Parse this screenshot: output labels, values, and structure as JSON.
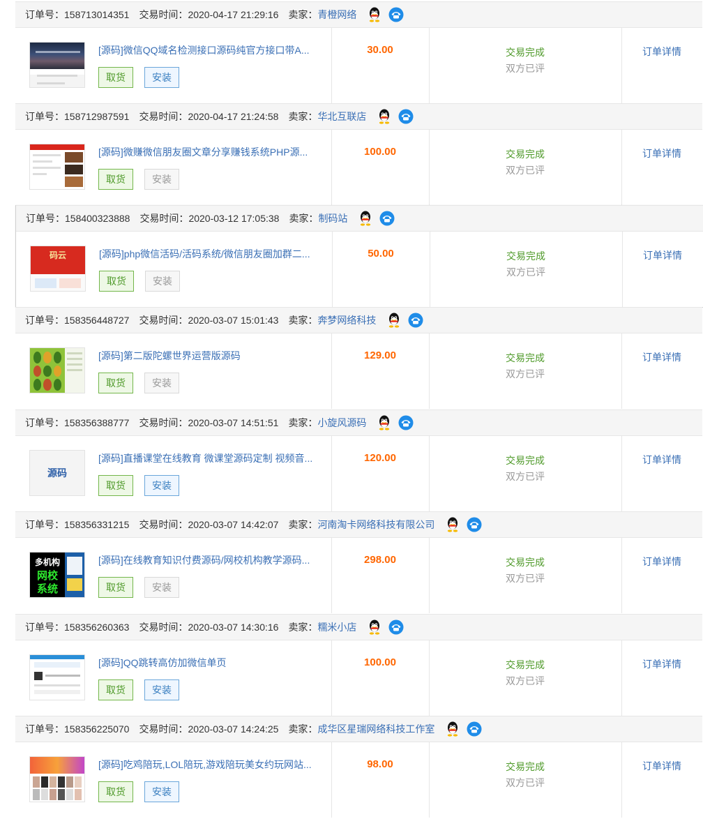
{
  "labels": {
    "order_no": "订单号：",
    "trade_time": "交易时间：",
    "seller": "卖家：",
    "take_button": "取货",
    "install_button": "安装",
    "status_main": "交易完成",
    "status_sub": "双方已评",
    "detail_link": "订单详情"
  },
  "colors": {
    "link": "#3a6fb5",
    "price": "#ff6600",
    "status_ok": "#4f9a2a",
    "muted": "#999999",
    "header_bg": "#f5f5f5"
  },
  "orders": [
    {
      "order_no": "158713014351",
      "time": "2020-04-17 21:29:16",
      "seller": "青橙网络",
      "title": "[源码]微信QQ域名检测接口源码纯官方接口带A...",
      "price": "30.00",
      "install_enabled": true,
      "thumb": "dark-banner"
    },
    {
      "order_no": "158712987591",
      "time": "2020-04-17 21:24:58",
      "seller": "华北互联店",
      "title": "[源码]微赚微信朋友圈文章分享赚钱系统PHP源...",
      "price": "100.00",
      "install_enabled": false,
      "thumb": "red-page"
    },
    {
      "order_no": "158400323888",
      "time": "2020-03-12 17:05:38",
      "seller": "制码站",
      "title": "[源码]php微信活码/活码系统/微信朋友圈加群二...",
      "price": "50.00",
      "install_enabled": false,
      "thumb": "red-banner-text",
      "thumb_text": "码云"
    },
    {
      "order_no": "158356448727",
      "time": "2020-03-07 15:01:43",
      "seller": "奔梦网络科技",
      "title": "[源码]第二版陀螺世界运营版源码",
      "price": "129.00",
      "install_enabled": false,
      "thumb": "green-app"
    },
    {
      "order_no": "158356388777",
      "time": "2020-03-07 14:51:51",
      "seller": "小旋风源码",
      "title": "[源码]直播课堂在线教育 微课堂源码定制 视频音...",
      "price": "120.00",
      "install_enabled": true,
      "thumb": "text",
      "thumb_text": "源码"
    },
    {
      "order_no": "158356331215",
      "time": "2020-03-07 14:42:07",
      "seller": "河南淘卡网络科技有限公司",
      "title": "[源码]在线教育知识付费源码/网校机构教学源码...",
      "price": "298.00",
      "install_enabled": false,
      "thumb": "black-green-text",
      "thumb_lines": [
        "多机构",
        "网校",
        "系统"
      ]
    },
    {
      "order_no": "158356260363",
      "time": "2020-03-07 14:30:16",
      "seller": "糯米小店",
      "title": "[源码]QQ跳转高仿加微信单页",
      "price": "100.00",
      "install_enabled": true,
      "thumb": "blue-mobile"
    },
    {
      "order_no": "158356225070",
      "time": "2020-03-07 14:24:25",
      "seller": "成华区星瑞网络科技工作室",
      "title": "[源码]吃鸡陪玩,LOL陪玩,游戏陪玩美女约玩网站...",
      "price": "98.00",
      "install_enabled": true,
      "thumb": "colorful-site"
    }
  ]
}
